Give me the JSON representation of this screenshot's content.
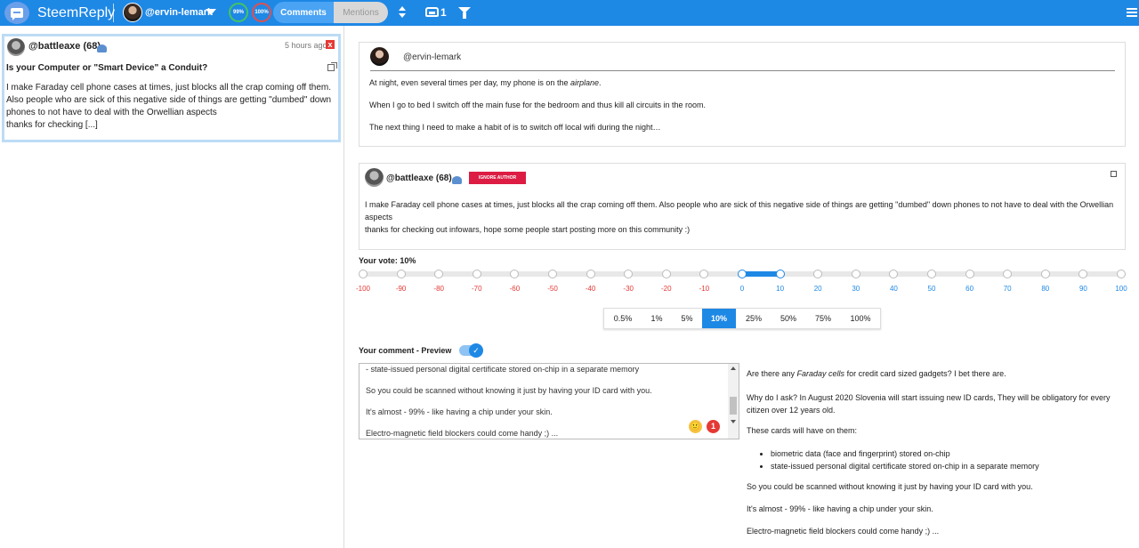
{
  "app": {
    "title": "SteemReply",
    "username": "@ervin-lemark",
    "gauge_green": "99%",
    "gauge_red": "100%",
    "tab_comments": "Comments",
    "tab_mentions": "Mentions",
    "inbox_count": "1"
  },
  "notification": {
    "author": "@battleaxe (68)",
    "time": "5 hours ago",
    "close": "x",
    "title": "Is your Computer or \"Smart Device\" a Conduit?",
    "body": "I make Faraday cell phone cases at times, just blocks all the crap coming off them. Also people who are sick of this negative side of things are getting \"dumbed\" down phones to not have to deal with the Orwellian aspects\nthanks for checking [...]"
  },
  "parent": {
    "author": "@ervin-lemark",
    "p1_before": "At night, even several times per day, my phone is on the ",
    "p1_em": "airplane",
    "p1_after": ".",
    "p2": "When I go to bed I switch off the main fuse for the bedroom and thus kill all circuits in the room.",
    "p3": "The next thing I need to make a habit of is to switch off local wifi during the night…"
  },
  "reply": {
    "author": "@battleaxe (68)",
    "ignore_label": "IGNORE AUTHOR",
    "body": "I make Faraday cell phone cases at times, just blocks all the crap coming off them. Also people who are sick of this negative side of things are getting \"dumbed\" down phones to not have to deal with the Orwellian aspects\nthanks for checking out infowars, hope some people start posting more on this community :)"
  },
  "vote": {
    "label": "Your vote: 10%",
    "value": 10,
    "ticks": [
      "-100",
      "-90",
      "-80",
      "-70",
      "-60",
      "-50",
      "-40",
      "-30",
      "-20",
      "-10",
      "0",
      "10",
      "20",
      "30",
      "40",
      "50",
      "60",
      "70",
      "80",
      "90",
      "100"
    ],
    "negative_color": "#e53935",
    "positive_color": "#1e88e5",
    "presets": [
      "0.5%",
      "1%",
      "5%",
      "10%",
      "25%",
      "50%",
      "75%",
      "100%"
    ],
    "active_preset": "10%"
  },
  "comment": {
    "label": "Your comment - Preview",
    "preview_enabled": true,
    "editor_lines": [
      "- state-issued personal digital certificate stored on-chip in a separate memory",
      "So you could be scanned without knowing it just by having your ID card with you.",
      "It's almost - 99% - like having a chip under your skin.",
      "Electro-magnetic field blockers could come handy ;) ..."
    ],
    "emoji": "🙂",
    "badge": "1"
  },
  "preview": {
    "p1_before": "Are there any ",
    "p1_em": "Faraday cells",
    "p1_after": " for credit card sized gadgets? I bet there are.",
    "p2": "Why do I ask? In August 2020 Slovenia will start issuing new ID cards, They will be obligatory for every citizen over 12 years old.",
    "p3": "These cards will have on them:",
    "list": [
      "biometric data (face and fingerprint) stored on-chip",
      "state-issued personal digital certificate stored on-chip in a separate memory"
    ],
    "p4": "So you could be scanned without knowing it just by having your ID card with you.",
    "p5": "It's almost - 99% - like having a chip under your skin.",
    "p6": "Electro-magnetic field blockers could come handy ;) ..."
  }
}
